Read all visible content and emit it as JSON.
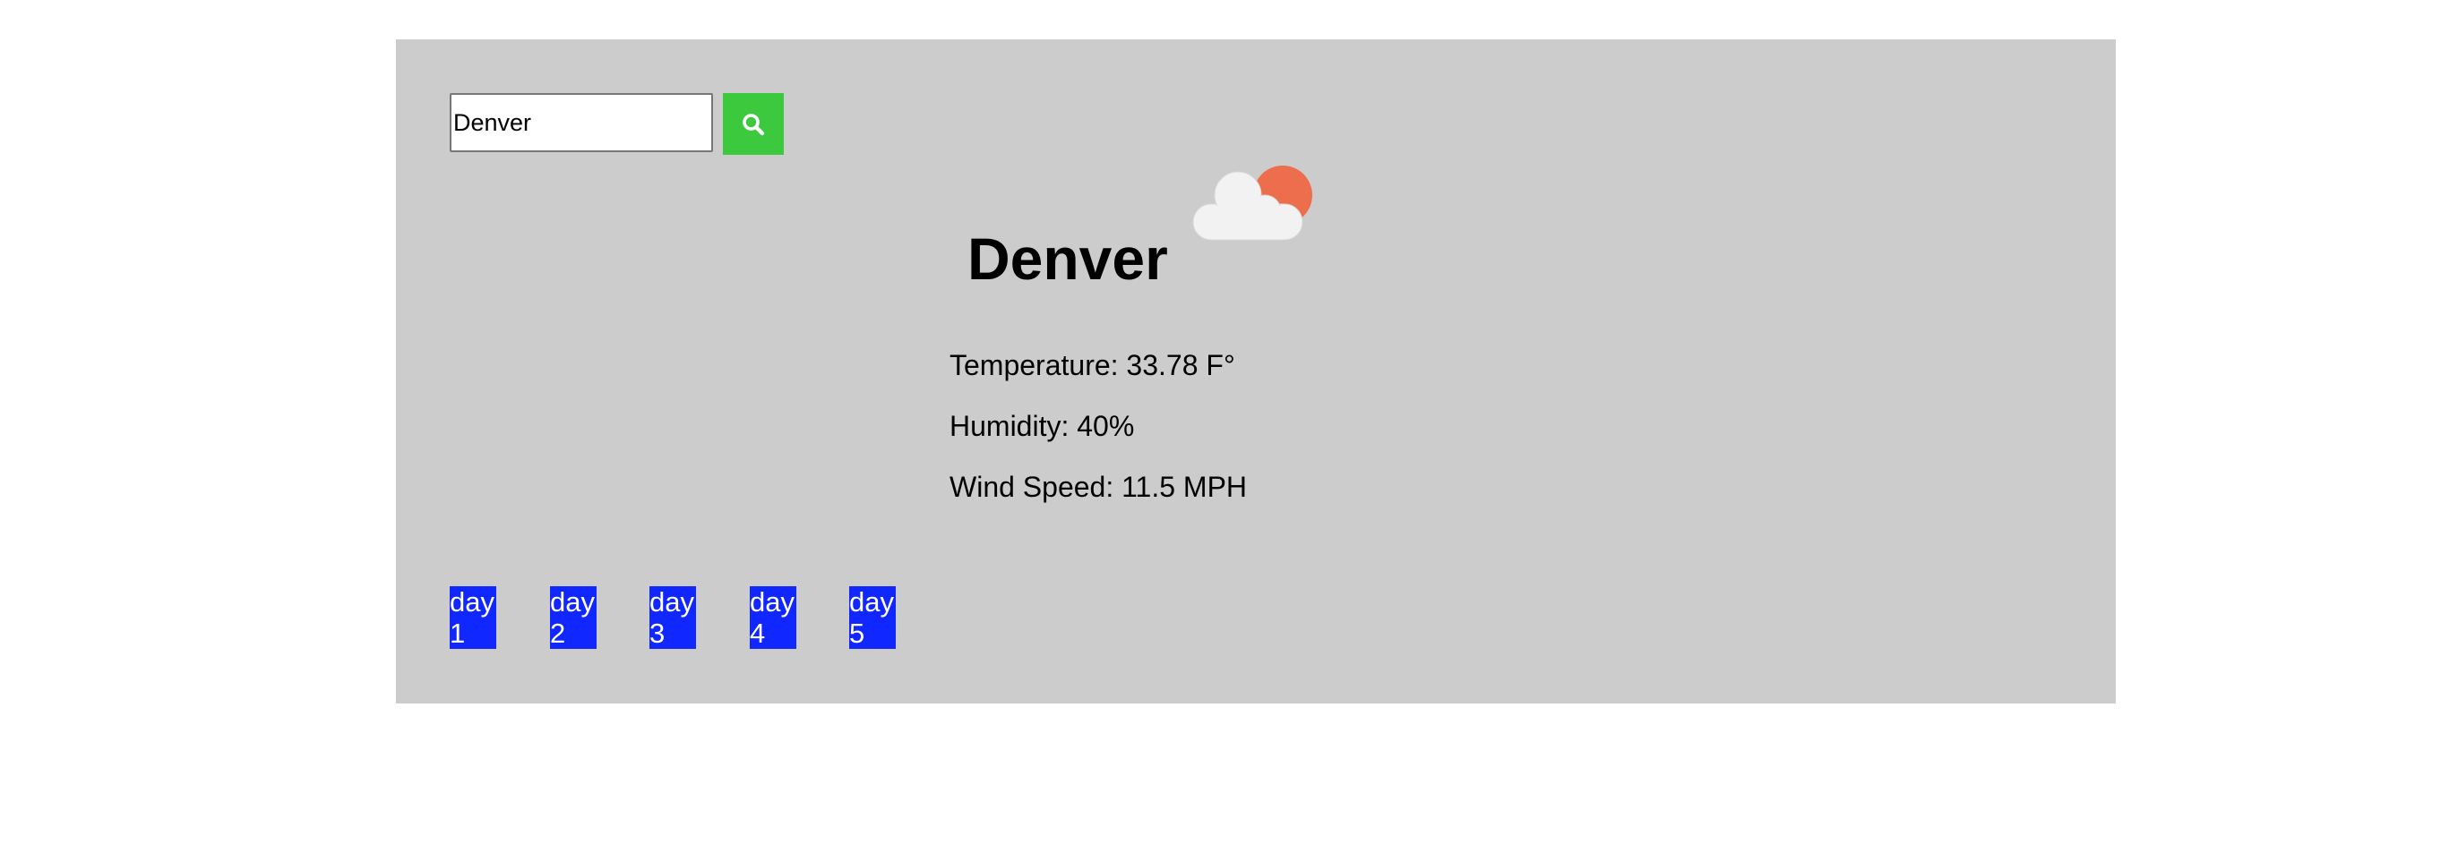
{
  "search": {
    "value": "Denver",
    "button_icon": "search-icon"
  },
  "weather": {
    "city": "Denver",
    "icon": "partly-cloudy-icon",
    "temperature": "Temperature: 33.78 F°",
    "humidity": "Humidity: 40%",
    "wind_speed": "Wind Speed: 11.5 MPH"
  },
  "forecast": {
    "days": [
      {
        "label": "day 1"
      },
      {
        "label": "day 2"
      },
      {
        "label": "day 3"
      },
      {
        "label": "day 4"
      },
      {
        "label": "day 5"
      }
    ]
  },
  "colors": {
    "panel_background": "#cccccc",
    "search_button": "#3dc93d",
    "day_card": "#1127ff",
    "sun": "#ec6e4c",
    "cloud": "#f2f2f2"
  }
}
